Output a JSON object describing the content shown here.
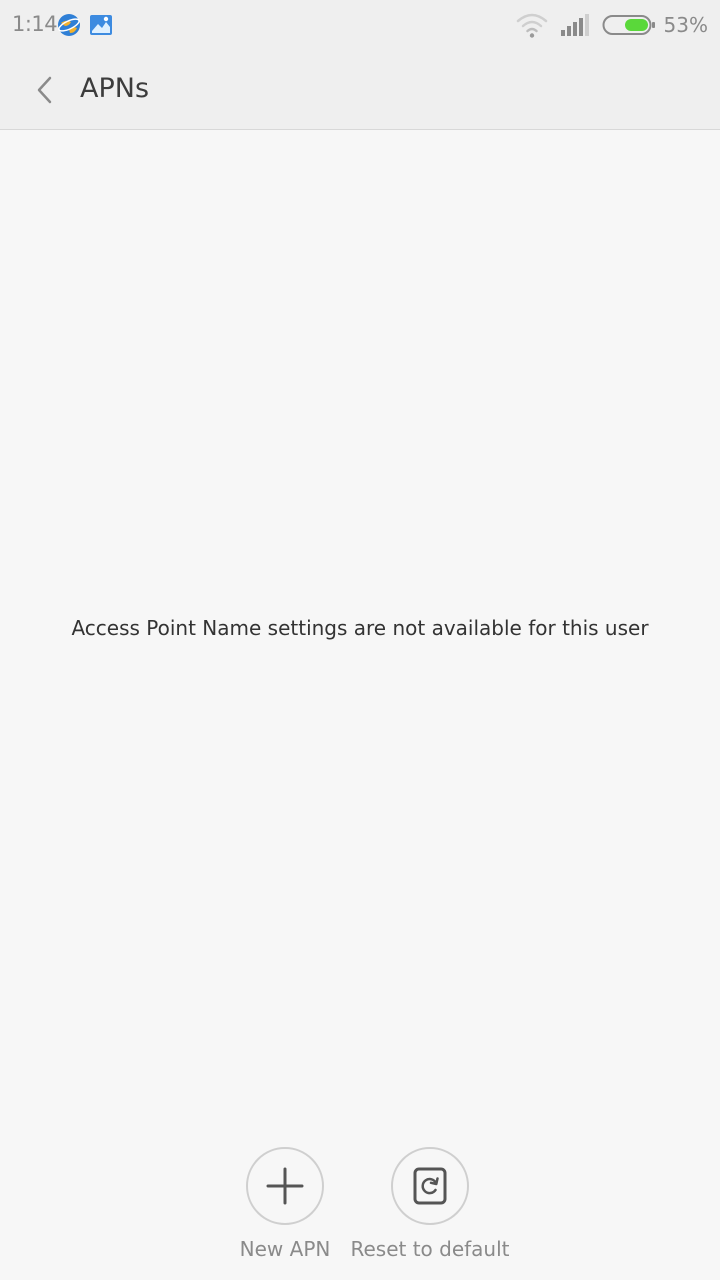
{
  "status_bar": {
    "time": "1:14",
    "battery_percent": "53%",
    "icons": [
      "browser-app-icon",
      "gallery-app-icon",
      "wifi-icon",
      "cellular-signal-icon",
      "battery-icon"
    ],
    "battery_color": "#5ad83a"
  },
  "header": {
    "title": "APNs",
    "back_icon": "chevron-left-icon"
  },
  "main": {
    "message": "Access Point Name settings are not available for this user"
  },
  "bottom_actions": {
    "new_apn_label": "New APN",
    "new_apn_icon": "plus-icon",
    "reset_label": "Reset to default",
    "reset_icon": "reset-icon"
  }
}
